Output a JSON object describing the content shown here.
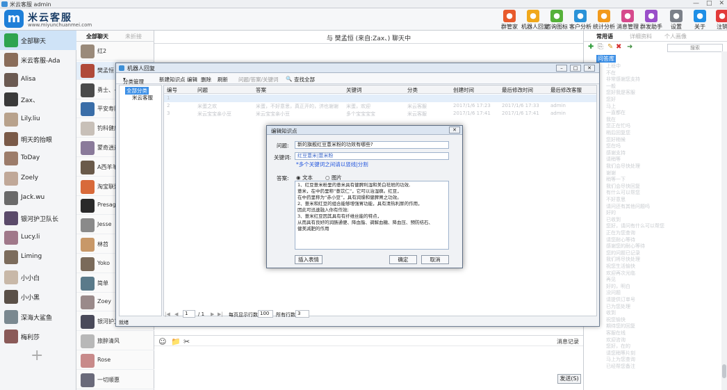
{
  "window": {
    "title": "米云客服 admin",
    "min": "—",
    "max": "□",
    "close": "✕"
  },
  "brand": {
    "logo_letter": "m",
    "name": "米云客服",
    "url": "www.miyunchuanmei.com"
  },
  "toolbar": [
    {
      "label": "群管家",
      "icon": "group-manager-icon",
      "color": "#e85b2d"
    },
    {
      "label": "机器人回复",
      "icon": "robot-icon",
      "color": "#f0a81c"
    },
    {
      "label": "咨询图标",
      "icon": "consult-icon",
      "color": "#56b13a"
    },
    {
      "label": "客户分析",
      "icon": "customer-analysis-icon",
      "color": "#2b93d8"
    },
    {
      "label": "统计分析",
      "icon": "statistics-icon",
      "color": "#f29a1d"
    },
    {
      "label": "消息管理",
      "icon": "message-icon",
      "color": "#d64a8d"
    },
    {
      "label": "群发助手",
      "icon": "broadcast-icon",
      "color": "#9a4fc9"
    },
    {
      "label": "设置",
      "icon": "settings-icon",
      "color": "#7b8089"
    },
    {
      "label": "关于",
      "icon": "about-icon",
      "color": "#1f8fe6"
    },
    {
      "label": "注销",
      "icon": "logout-icon",
      "color": "#e23a3a"
    }
  ],
  "left_list": [
    {
      "name": "全部聊天",
      "color": "#2ea44f"
    },
    {
      "name": "米云客服-Ada",
      "color": "#8a6d5a"
    },
    {
      "name": "Alisa",
      "color": "#6b5a52"
    },
    {
      "name": "Zax、",
      "color": "#3a3a3a"
    },
    {
      "name": "Lily.liu",
      "color": "#b8a28c"
    },
    {
      "name": "明天的抬眼",
      "color": "#7a5a48"
    },
    {
      "name": "ToDay",
      "color": "#9c7c6a"
    },
    {
      "name": "Zoely",
      "color": "#c0a898"
    },
    {
      "name": "Jack.wu",
      "color": "#6a6a6a"
    },
    {
      "name": "银河护卫队长",
      "color": "#5a4a6a"
    },
    {
      "name": "Lucy.li",
      "color": "#a0788a"
    },
    {
      "name": "Liming",
      "color": "#7c6c5c"
    },
    {
      "name": "小小白",
      "color": "#c8b8a8"
    },
    {
      "name": "小小黑",
      "color": "#5a5048"
    },
    {
      "name": "深海大鲨鱼",
      "color": "#7a8890"
    },
    {
      "name": "梅利莎",
      "color": "#8a5a58"
    }
  ],
  "add_symbol": "+",
  "col2": {
    "tab_all": "全部聊天",
    "tab_unreplied": "未折接",
    "items": [
      {
        "name": "红2",
        "color": "#9a8a7a"
      },
      {
        "name": "樊孟恒",
        "color": "#b04a3a"
      },
      {
        "name": "勇士、~",
        "color": "#4a4a4a"
      },
      {
        "name": "平安寿险",
        "color": "#3a6ea8"
      },
      {
        "name": "钓科健康",
        "color": "#c8c0b8"
      },
      {
        "name": "蒙奇逍遥",
        "color": "#8a7a9a"
      },
      {
        "name": "A西羊羊",
        "color": "#6a5a4a"
      },
      {
        "name": "淘宝联盟",
        "color": "#d86a3a"
      },
      {
        "name": "Presage",
        "color": "#2a2a2a"
      },
      {
        "name": "Jesse",
        "color": "#8a8a8a"
      },
      {
        "name": "林苕",
        "color": "#c89868"
      },
      {
        "name": "Yoko",
        "color": "#7a6a5a"
      },
      {
        "name": "简单",
        "color": "#5a7a8a"
      },
      {
        "name": "Zoey",
        "color": "#9a8a8a"
      },
      {
        "name": "银河护卫",
        "color": "#4a4a5a"
      },
      {
        "name": "旅醉清风",
        "color": "#b8b8b8"
      },
      {
        "name": "Rose",
        "color": "#c88a8a"
      },
      {
        "name": "一切顺惠",
        "color": "#6a6a7a"
      }
    ]
  },
  "chat": {
    "title": "与 樊孟恒 (来自:Zax、) 聊天中",
    "tools": [
      "☺",
      "📁",
      "✂"
    ],
    "record_label": "消息记录",
    "send_label": "发送(S)"
  },
  "right": {
    "tab_common": "常用语",
    "tab_detail": "详细资料",
    "tab_profile": "个人画像",
    "search_placeholder": "搜索",
    "root_label": "问答库",
    "faded_items": [
      "上班中",
      "不在",
      "非常感谢您支持",
      "一般",
      "您好我是客服",
      "您好",
      "马上",
      "一直都在",
      "我在",
      "您正在忙吗",
      "稍后回复您",
      "您好稍候",
      "您在吗",
      "感谢支持",
      "请稍等",
      "我们会尽快处理",
      "谢谢",
      "稍等一下",
      "我们会尽快回复",
      "有什么可以帮您",
      "不好意思",
      "请问还有其他问题吗",
      "好的",
      "已收到",
      "您好，请问有什么可以帮您",
      "正在为您查询",
      "请您耐心等待",
      "感谢您的耐心等待",
      "您的问题已记录",
      "我们将尽快处理",
      "祝您生活愉快",
      "欢迎再次光临",
      "再见",
      "好的，明白",
      "没问题",
      "请提供订单号",
      "已为您处理",
      "收到",
      "祝您愉快",
      "期待您的回复",
      "客服在线",
      "欢迎咨询",
      "您好，在的",
      "请您稍等片刻",
      "马上为您查询",
      "已经帮您备注"
    ]
  },
  "robot": {
    "title": "机器人回复",
    "menu_category": "分类管理",
    "menu_new": "新建知识点",
    "menu_edit": "编辑",
    "menu_delete": "删除",
    "menu_refresh": "刷新",
    "search_placeholder": "问题/答案/关键词",
    "search_all": "查找全部",
    "tree_root": "全部分类",
    "tree_child": "米云客服",
    "columns": [
      "编号",
      "问题",
      "答案",
      "关键词",
      "分类",
      "创建时间",
      "最后修改时间",
      "最后修改客服"
    ],
    "rows": [
      [
        "1",
        "",
        "",
        "",
        "",
        "",
        "",
        ""
      ],
      [
        "2",
        "米蛋之欢",
        "米蛋，不好意思，真正开的，济也谢谢",
        "米蛋，欢迎",
        "米云客服",
        "2017/1/6 17:23",
        "2017/1/6 17:33",
        "admin"
      ],
      [
        "3",
        "米云宝宝亲小豆",
        "米云宝宝亲小豆",
        "多个宝宝宝宝",
        "米云客服",
        "2017/1/6 17:41",
        "2017/1/6 17:41",
        "admin"
      ]
    ],
    "pager_current": "1",
    "pager_sep": "/ 1",
    "pager_per_page_label": "每页显示行数",
    "pager_per_page": "100",
    "pager_total_label": "所有行数",
    "pager_total": "3",
    "status": "就绪"
  },
  "edit": {
    "title": "编辑知识点",
    "question_label": "问题:",
    "question_value": "新的旗舰红豆薏米粉的功效有哪些?",
    "keyword_label": "关键词:",
    "keyword_value": "红豆薏米|薏米粉",
    "keyword_hint": "*多个关键词之间请以竖线|分割",
    "answer_label": "答案:",
    "radio_text": "文本",
    "radio_image": "图片",
    "answer_lines": [
      "1、红豆薏米粉里的薏米具有健脾利湿和美白祛斑的功效,",
      "薏米，在中药里称“薏苡仁”，它可以治湿痹。红豆，",
      "在中药里称为“赤小豆”，具有润燥和健脾胃之功效。",
      "2、薏米和红豆的组合能够增强胃功能，具有清热利尿的作用，",
      "因此可迅速融入你有作效;",
      "3、薏米红豆因其具有有纤维丝能的特点，",
      "从而具有良好的润肠通便、降血脂、调解血糖、降血压、预防结石、",
      "健美减肥的作用"
    ],
    "insert_emoji": "插入表情",
    "ok": "确定",
    "cancel": "取消"
  }
}
